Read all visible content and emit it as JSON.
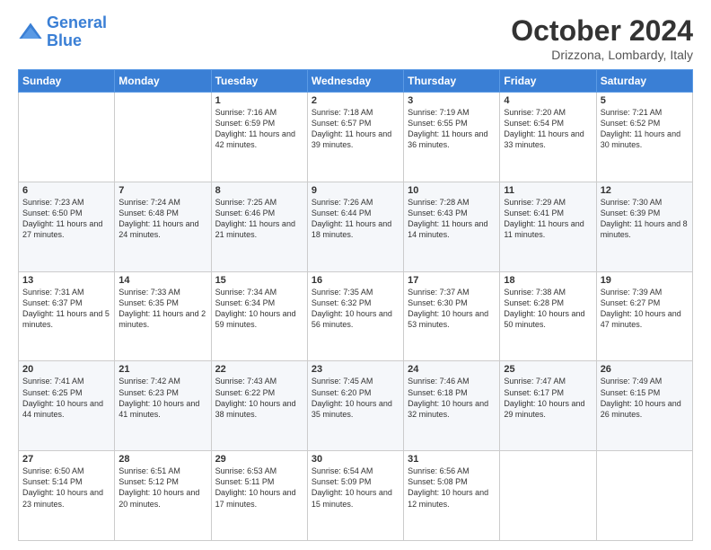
{
  "logo": {
    "line1": "General",
    "line2": "Blue"
  },
  "title": "October 2024",
  "location": "Drizzona, Lombardy, Italy",
  "days_of_week": [
    "Sunday",
    "Monday",
    "Tuesday",
    "Wednesday",
    "Thursday",
    "Friday",
    "Saturday"
  ],
  "weeks": [
    [
      {
        "day": "",
        "info": ""
      },
      {
        "day": "",
        "info": ""
      },
      {
        "day": "1",
        "info": "Sunrise: 7:16 AM\nSunset: 6:59 PM\nDaylight: 11 hours and 42 minutes."
      },
      {
        "day": "2",
        "info": "Sunrise: 7:18 AM\nSunset: 6:57 PM\nDaylight: 11 hours and 39 minutes."
      },
      {
        "day": "3",
        "info": "Sunrise: 7:19 AM\nSunset: 6:55 PM\nDaylight: 11 hours and 36 minutes."
      },
      {
        "day": "4",
        "info": "Sunrise: 7:20 AM\nSunset: 6:54 PM\nDaylight: 11 hours and 33 minutes."
      },
      {
        "day": "5",
        "info": "Sunrise: 7:21 AM\nSunset: 6:52 PM\nDaylight: 11 hours and 30 minutes."
      }
    ],
    [
      {
        "day": "6",
        "info": "Sunrise: 7:23 AM\nSunset: 6:50 PM\nDaylight: 11 hours and 27 minutes."
      },
      {
        "day": "7",
        "info": "Sunrise: 7:24 AM\nSunset: 6:48 PM\nDaylight: 11 hours and 24 minutes."
      },
      {
        "day": "8",
        "info": "Sunrise: 7:25 AM\nSunset: 6:46 PM\nDaylight: 11 hours and 21 minutes."
      },
      {
        "day": "9",
        "info": "Sunrise: 7:26 AM\nSunset: 6:44 PM\nDaylight: 11 hours and 18 minutes."
      },
      {
        "day": "10",
        "info": "Sunrise: 7:28 AM\nSunset: 6:43 PM\nDaylight: 11 hours and 14 minutes."
      },
      {
        "day": "11",
        "info": "Sunrise: 7:29 AM\nSunset: 6:41 PM\nDaylight: 11 hours and 11 minutes."
      },
      {
        "day": "12",
        "info": "Sunrise: 7:30 AM\nSunset: 6:39 PM\nDaylight: 11 hours and 8 minutes."
      }
    ],
    [
      {
        "day": "13",
        "info": "Sunrise: 7:31 AM\nSunset: 6:37 PM\nDaylight: 11 hours and 5 minutes."
      },
      {
        "day": "14",
        "info": "Sunrise: 7:33 AM\nSunset: 6:35 PM\nDaylight: 11 hours and 2 minutes."
      },
      {
        "day": "15",
        "info": "Sunrise: 7:34 AM\nSunset: 6:34 PM\nDaylight: 10 hours and 59 minutes."
      },
      {
        "day": "16",
        "info": "Sunrise: 7:35 AM\nSunset: 6:32 PM\nDaylight: 10 hours and 56 minutes."
      },
      {
        "day": "17",
        "info": "Sunrise: 7:37 AM\nSunset: 6:30 PM\nDaylight: 10 hours and 53 minutes."
      },
      {
        "day": "18",
        "info": "Sunrise: 7:38 AM\nSunset: 6:28 PM\nDaylight: 10 hours and 50 minutes."
      },
      {
        "day": "19",
        "info": "Sunrise: 7:39 AM\nSunset: 6:27 PM\nDaylight: 10 hours and 47 minutes."
      }
    ],
    [
      {
        "day": "20",
        "info": "Sunrise: 7:41 AM\nSunset: 6:25 PM\nDaylight: 10 hours and 44 minutes."
      },
      {
        "day": "21",
        "info": "Sunrise: 7:42 AM\nSunset: 6:23 PM\nDaylight: 10 hours and 41 minutes."
      },
      {
        "day": "22",
        "info": "Sunrise: 7:43 AM\nSunset: 6:22 PM\nDaylight: 10 hours and 38 minutes."
      },
      {
        "day": "23",
        "info": "Sunrise: 7:45 AM\nSunset: 6:20 PM\nDaylight: 10 hours and 35 minutes."
      },
      {
        "day": "24",
        "info": "Sunrise: 7:46 AM\nSunset: 6:18 PM\nDaylight: 10 hours and 32 minutes."
      },
      {
        "day": "25",
        "info": "Sunrise: 7:47 AM\nSunset: 6:17 PM\nDaylight: 10 hours and 29 minutes."
      },
      {
        "day": "26",
        "info": "Sunrise: 7:49 AM\nSunset: 6:15 PM\nDaylight: 10 hours and 26 minutes."
      }
    ],
    [
      {
        "day": "27",
        "info": "Sunrise: 6:50 AM\nSunset: 5:14 PM\nDaylight: 10 hours and 23 minutes."
      },
      {
        "day": "28",
        "info": "Sunrise: 6:51 AM\nSunset: 5:12 PM\nDaylight: 10 hours and 20 minutes."
      },
      {
        "day": "29",
        "info": "Sunrise: 6:53 AM\nSunset: 5:11 PM\nDaylight: 10 hours and 17 minutes."
      },
      {
        "day": "30",
        "info": "Sunrise: 6:54 AM\nSunset: 5:09 PM\nDaylight: 10 hours and 15 minutes."
      },
      {
        "day": "31",
        "info": "Sunrise: 6:56 AM\nSunset: 5:08 PM\nDaylight: 10 hours and 12 minutes."
      },
      {
        "day": "",
        "info": ""
      },
      {
        "day": "",
        "info": ""
      }
    ]
  ]
}
